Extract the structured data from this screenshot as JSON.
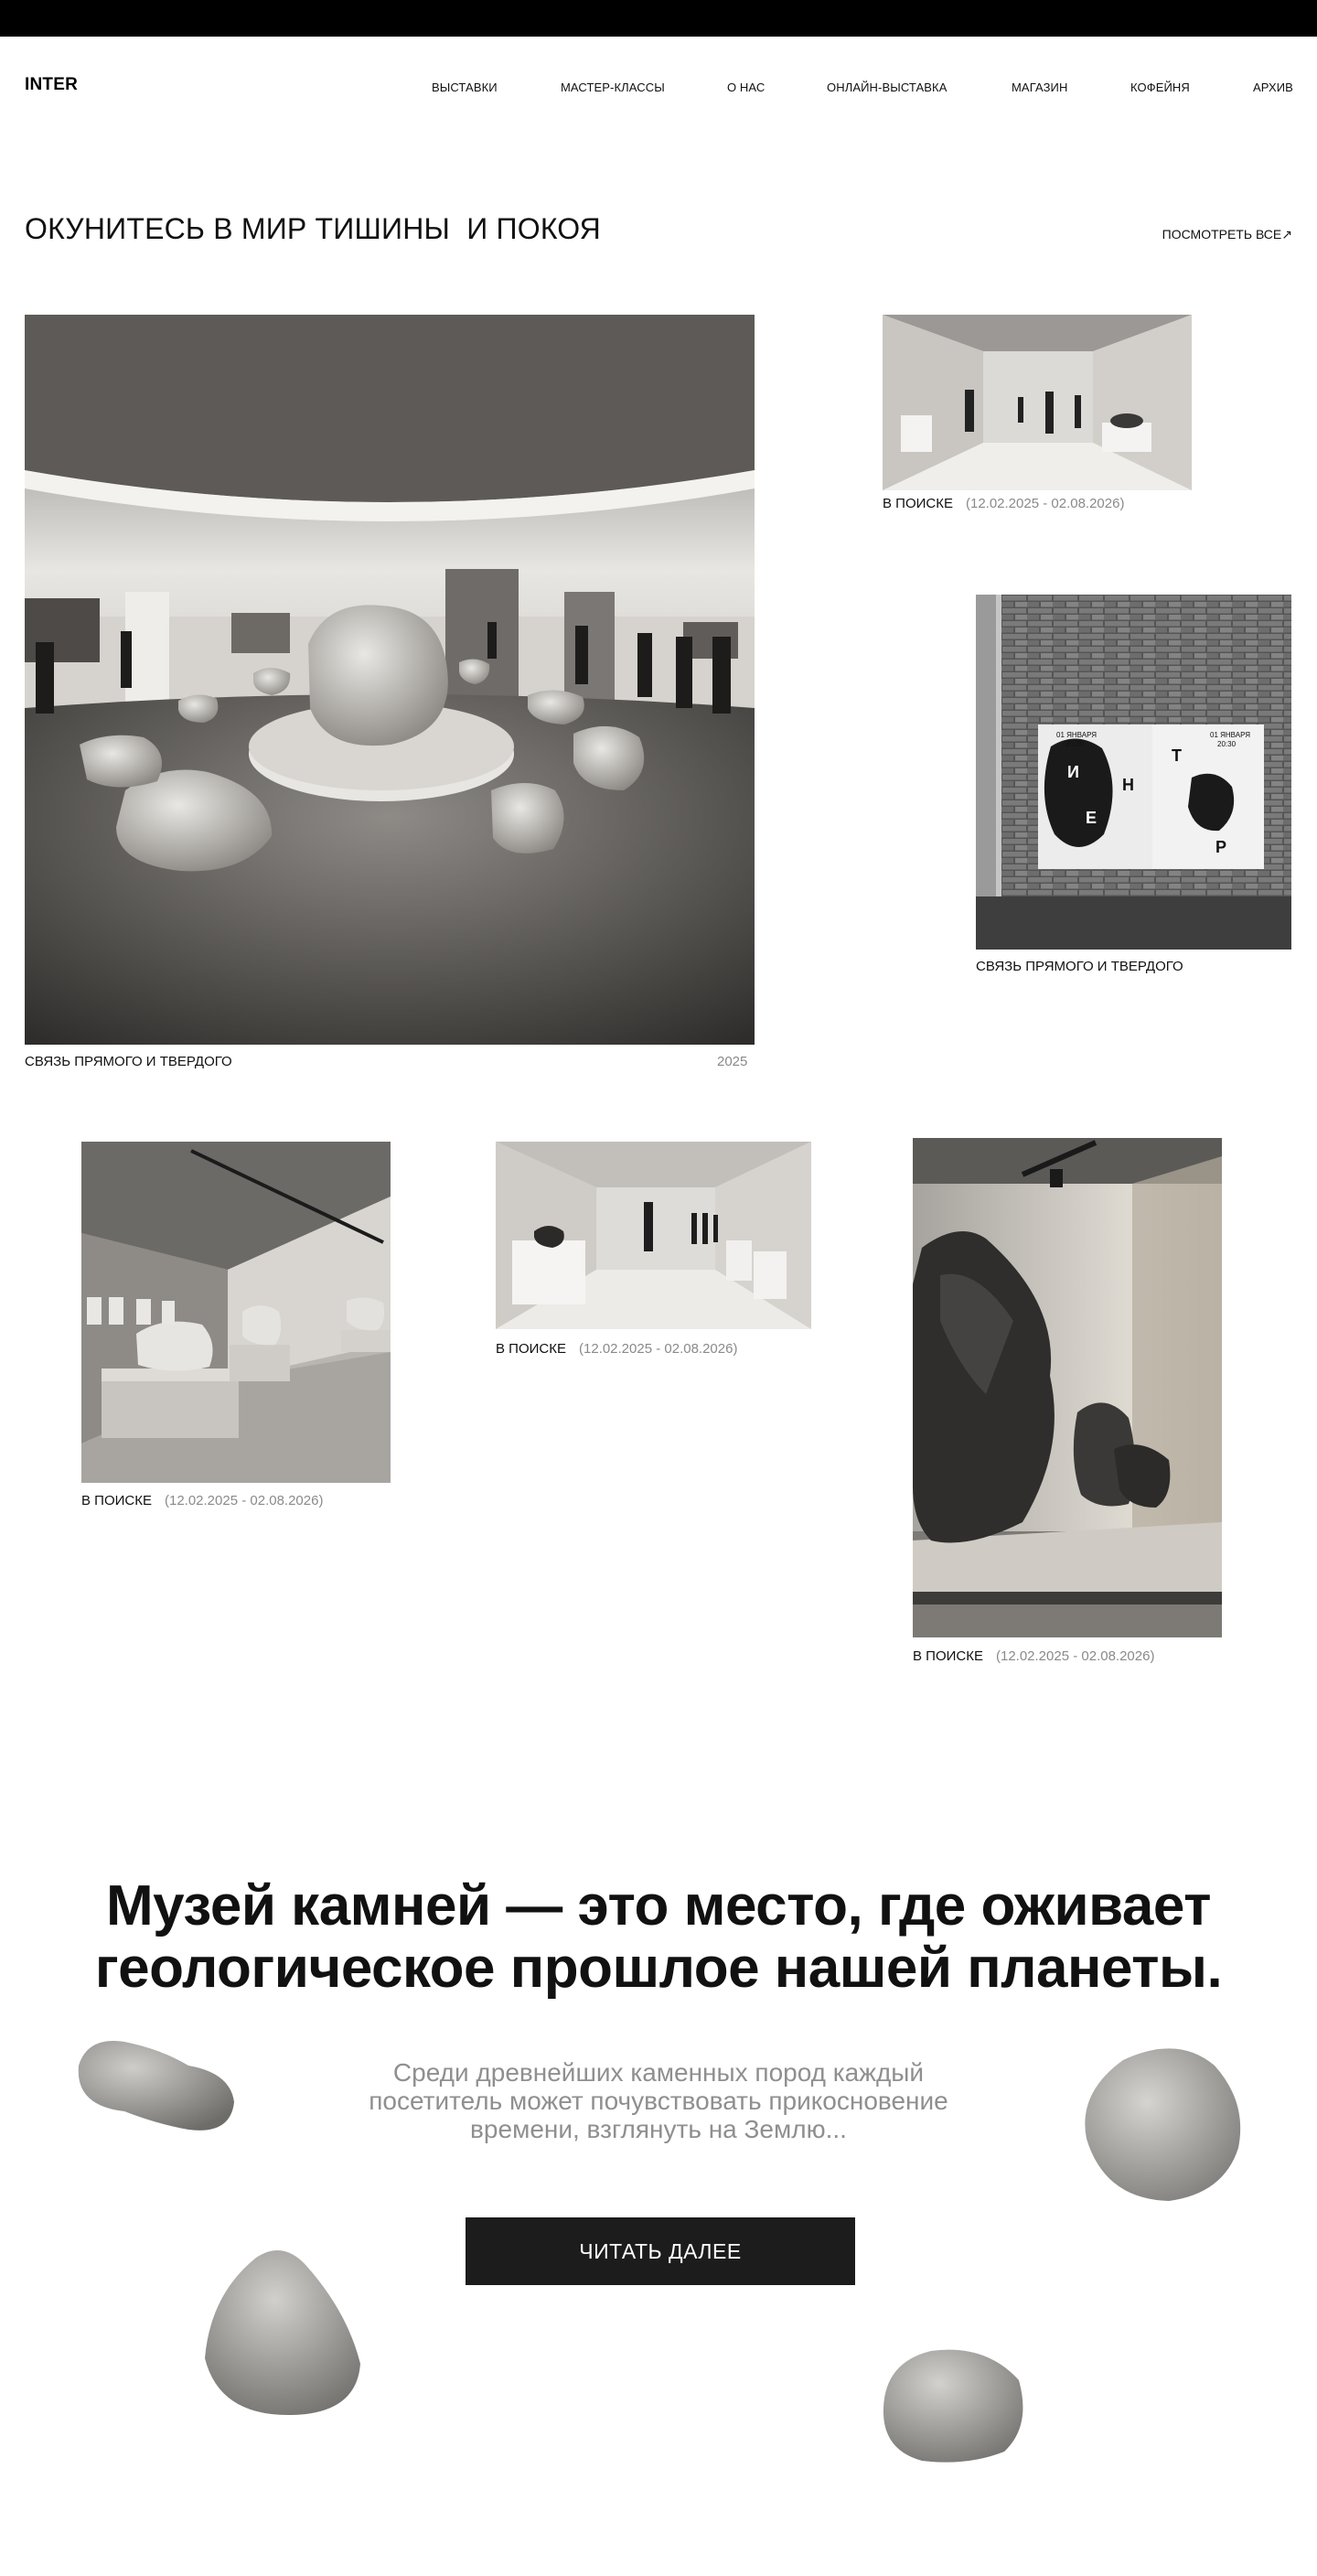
{
  "header": {
    "logo": "INTER",
    "nav": [
      {
        "label": "ВЫСТАВКИ"
      },
      {
        "label": "МАСТЕР-КЛАССЫ"
      },
      {
        "label": "О НАС"
      },
      {
        "label": "ОНЛАЙН-ВЫСТАВКА"
      },
      {
        "label": "МАГАЗИН"
      },
      {
        "label": "КОФЕЙНЯ"
      },
      {
        "label": "АРХИВ"
      }
    ]
  },
  "section": {
    "title": "ОКУНИТЕСЬ В МИР ТИШИНЫ  И ПОКОЯ",
    "view_all": "ПОСМОТРЕТЬ ВСЕ↗"
  },
  "exhibitions": [
    {
      "label": "СВЯЗЬ ПРЯМОГО И ТВЕРДОГО",
      "year": "2025"
    },
    {
      "label": "В ПОИСКЕ",
      "date": "(12.02.2025 - 02.08.2026)"
    },
    {
      "label": "СВЯЗЬ ПРЯМОГО И ТВЕРДОГО"
    },
    {
      "label": "В ПОИСКЕ",
      "date": "(12.02.2025 - 02.08.2026)"
    },
    {
      "label": "В ПОИСКЕ",
      "date": "(12.02.2025 - 02.08.2026)"
    },
    {
      "label": "В ПОИСКЕ",
      "date": "(12.02.2025 - 02.08.2026)"
    }
  ],
  "poster": {
    "left_header": "01 ЯНВАРЯ\n20:30",
    "right_header": "01 ЯНВАРЯ\n20:30",
    "letters": [
      "И",
      "Н",
      "Т",
      "Е",
      "Р"
    ]
  },
  "about": {
    "headline_line1": "Музей камней — это место, где оживает",
    "headline_line2": "геологическое прошлое нашей планеты.",
    "lead_line1": "Среди древнейших каменных пород каждый",
    "lead_line2": "посетитель может почувствовать прикосновение",
    "lead_line3": "времени, взглянуть на Землю...",
    "cta": "ЧИТАТЬ ДАЛЕЕ"
  },
  "colors": {
    "topbar": "#000000",
    "button": "#1c1c1c",
    "muted_text": "#8a8a8a"
  }
}
